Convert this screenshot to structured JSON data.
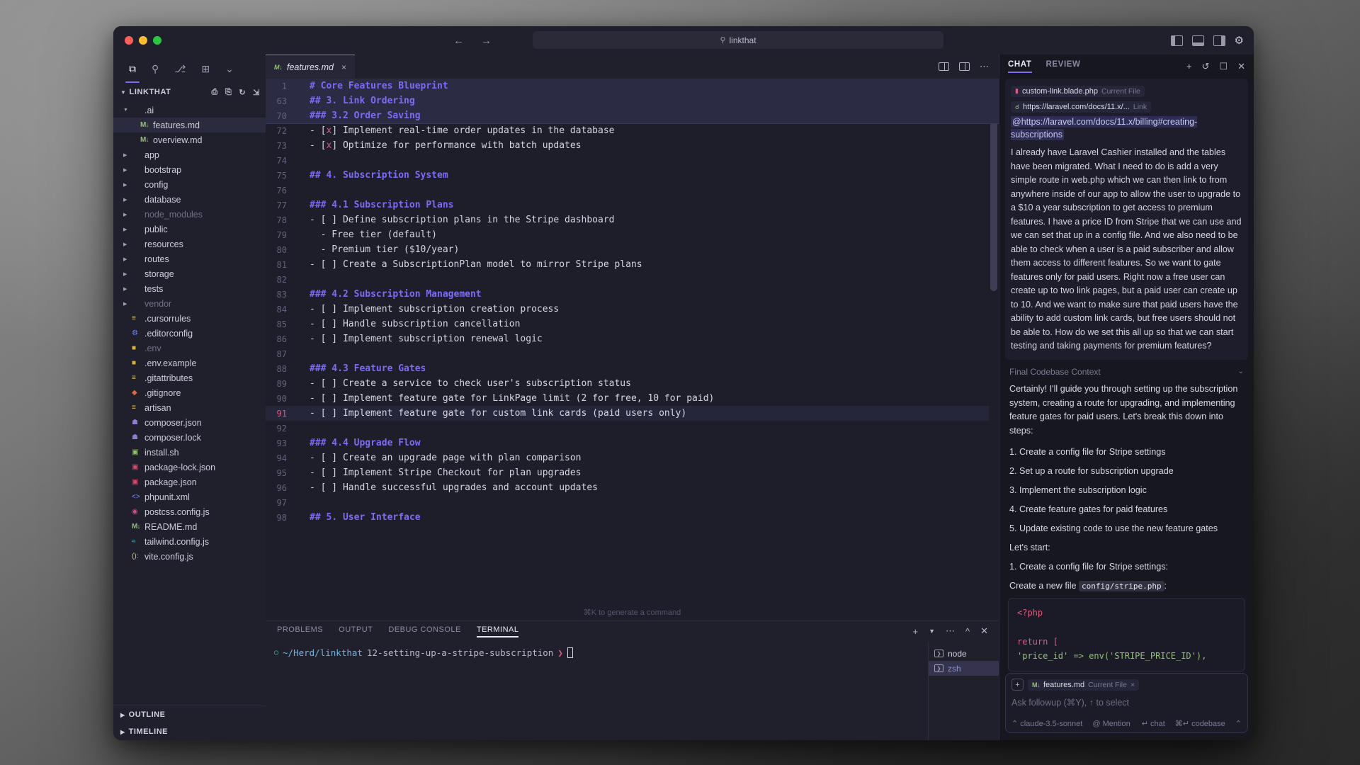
{
  "titlebar": {
    "search_value": "linkthat",
    "search_icon": "magnifier-icon",
    "back_icon": "←",
    "forward_icon": "→",
    "gear_icon": "⚙"
  },
  "activitybar": {
    "items": [
      {
        "name": "explorer",
        "glyph": "⧉"
      },
      {
        "name": "search",
        "glyph": "⚲"
      },
      {
        "name": "source-control",
        "glyph": "⎇"
      },
      {
        "name": "extensions",
        "glyph": "⊞"
      },
      {
        "name": "more",
        "glyph": "⌄"
      }
    ]
  },
  "sidebar": {
    "title": "LINKTHAT",
    "actions": [
      "new-file",
      "new-folder",
      "refresh",
      "collapse-all"
    ],
    "tree": [
      {
        "label": ".ai",
        "type": "folder",
        "expanded": true,
        "indent": 0
      },
      {
        "label": "features.md",
        "type": "md",
        "indent": 1,
        "selected": true
      },
      {
        "label": "overview.md",
        "type": "md",
        "indent": 1
      },
      {
        "label": "app",
        "type": "folder",
        "indent": 0
      },
      {
        "label": "bootstrap",
        "type": "folder",
        "indent": 0
      },
      {
        "label": "config",
        "type": "folder",
        "indent": 0
      },
      {
        "label": "database",
        "type": "folder",
        "indent": 0
      },
      {
        "label": "node_modules",
        "type": "folder",
        "indent": 0,
        "dim": true
      },
      {
        "label": "public",
        "type": "folder",
        "indent": 0
      },
      {
        "label": "resources",
        "type": "folder",
        "indent": 0
      },
      {
        "label": "routes",
        "type": "folder",
        "indent": 0
      },
      {
        "label": "storage",
        "type": "folder",
        "indent": 0
      },
      {
        "label": "tests",
        "type": "folder",
        "indent": 0
      },
      {
        "label": "vendor",
        "type": "folder",
        "indent": 0,
        "dim": true
      },
      {
        "label": ".cursorrules",
        "type": "text",
        "indent": 0
      },
      {
        "label": ".editorconfig",
        "type": "gear",
        "indent": 0
      },
      {
        "label": ".env",
        "type": "lock",
        "indent": 0,
        "dim": true
      },
      {
        "label": ".env.example",
        "type": "lock",
        "indent": 0
      },
      {
        "label": ".gitattributes",
        "type": "text",
        "indent": 0
      },
      {
        "label": ".gitignore",
        "type": "git",
        "indent": 0
      },
      {
        "label": "artisan",
        "type": "text",
        "indent": 0
      },
      {
        "label": "composer.json",
        "type": "composer",
        "indent": 0
      },
      {
        "label": "composer.lock",
        "type": "composer",
        "indent": 0
      },
      {
        "label": "install.sh",
        "type": "shell",
        "indent": 0
      },
      {
        "label": "package-lock.json",
        "type": "npm",
        "indent": 0
      },
      {
        "label": "package.json",
        "type": "npm",
        "indent": 0
      },
      {
        "label": "phpunit.xml",
        "type": "xml",
        "indent": 0
      },
      {
        "label": "postcss.config.js",
        "type": "postcss",
        "indent": 0
      },
      {
        "label": "README.md",
        "type": "md",
        "indent": 0
      },
      {
        "label": "tailwind.config.js",
        "type": "tailwind",
        "indent": 0
      },
      {
        "label": "vite.config.js",
        "type": "vite",
        "indent": 0
      }
    ],
    "bottom_sections": [
      "OUTLINE",
      "TIMELINE"
    ]
  },
  "editor": {
    "tab": {
      "label": "features.md",
      "icon": "markdown-icon",
      "close": "×"
    },
    "actions": [
      "split-editor",
      "layout-toggle",
      "more-actions"
    ],
    "sticky_lines": [
      {
        "num": "1",
        "text": "# Core Features Blueprint",
        "style": "h"
      },
      {
        "num": "63",
        "text": "## 3. Link Ordering",
        "style": "h"
      },
      {
        "num": "70",
        "text": "### 3.2 Order Saving",
        "style": "h"
      }
    ],
    "lines": [
      {
        "num": "72",
        "text": "- [x] Implement real-time order updates in the database",
        "style": "task-done"
      },
      {
        "num": "73",
        "text": "- [x] Optimize for performance with batch updates",
        "style": "task-done"
      },
      {
        "num": "74",
        "text": "",
        "style": "blank"
      },
      {
        "num": "75",
        "text": "## 4. Subscription System",
        "style": "h"
      },
      {
        "num": "76",
        "text": "",
        "style": "blank"
      },
      {
        "num": "77",
        "text": "### 4.1 Subscription Plans",
        "style": "h"
      },
      {
        "num": "78",
        "text": "- [ ] Define subscription plans in the Stripe dashboard",
        "style": "task"
      },
      {
        "num": "79",
        "text": "  - Free tier (default)",
        "style": "plain"
      },
      {
        "num": "80",
        "text": "  - Premium tier ($10/year)",
        "style": "plain"
      },
      {
        "num": "81",
        "text": "- [ ] Create a SubscriptionPlan model to mirror Stripe plans",
        "style": "task"
      },
      {
        "num": "82",
        "text": "",
        "style": "blank"
      },
      {
        "num": "83",
        "text": "### 4.2 Subscription Management",
        "style": "h"
      },
      {
        "num": "84",
        "text": "- [ ] Implement subscription creation process",
        "style": "task"
      },
      {
        "num": "85",
        "text": "- [ ] Handle subscription cancellation",
        "style": "task"
      },
      {
        "num": "86",
        "text": "- [ ] Implement subscription renewal logic",
        "style": "task"
      },
      {
        "num": "87",
        "text": "",
        "style": "blank"
      },
      {
        "num": "88",
        "text": "### 4.3 Feature Gates",
        "style": "h"
      },
      {
        "num": "89",
        "text": "- [ ] Create a service to check user's subscription status",
        "style": "task"
      },
      {
        "num": "90",
        "text": "- [ ] Implement feature gate for LinkPage limit (2 for free, 10 for paid)",
        "style": "task"
      },
      {
        "num": "91",
        "text": "- [ ] Implement feature gate for custom link cards (paid users only)",
        "style": "task",
        "current": true
      },
      {
        "num": "92",
        "text": "",
        "style": "blank"
      },
      {
        "num": "93",
        "text": "### 4.4 Upgrade Flow",
        "style": "h"
      },
      {
        "num": "94",
        "text": "- [ ] Create an upgrade page with plan comparison",
        "style": "task"
      },
      {
        "num": "95",
        "text": "- [ ] Implement Stripe Checkout for plan upgrades",
        "style": "task"
      },
      {
        "num": "96",
        "text": "- [ ] Handle successful upgrades and account updates",
        "style": "task"
      },
      {
        "num": "97",
        "text": "",
        "style": "blank"
      },
      {
        "num": "98",
        "text": "## 5. User Interface",
        "style": "h"
      }
    ],
    "generate_hint": "⌘K to generate a command"
  },
  "panel": {
    "tabs": [
      {
        "label": "PROBLEMS",
        "active": false
      },
      {
        "label": "OUTPUT",
        "active": false
      },
      {
        "label": "DEBUG CONSOLE",
        "active": false
      },
      {
        "label": "TERMINAL",
        "active": true
      }
    ],
    "actions": [
      "add-terminal",
      "split-terminal",
      "more",
      "chevron-up",
      "close-panel"
    ],
    "terminal": {
      "status_dot": "○",
      "path": "~/Herd/linkthat",
      "branch": "12-setting-up-a-stripe-subscription",
      "arrow": "❯",
      "cursor": ""
    },
    "terminal_list": [
      {
        "label": "node",
        "selected": false
      },
      {
        "label": "zsh",
        "selected": true
      }
    ]
  },
  "chat": {
    "tabs": [
      {
        "label": "CHAT",
        "active": true
      },
      {
        "label": "REVIEW",
        "active": false
      }
    ],
    "actions": [
      "new-chat",
      "history",
      "expand",
      "close"
    ],
    "user_message": {
      "chips": [
        {
          "label": "custom-link.blade.php",
          "sub": "Current File",
          "icon": "blade-icon"
        },
        {
          "label": "https://laravel.com/docs/11.x/...",
          "sub": "Link",
          "icon": "link-icon"
        }
      ],
      "mention": "@https://laravel.com/docs/11.x/billing#creating-subscriptions",
      "text": "I already have Laravel Cashier installed and the tables have been migrated. What I need to do is add a very simple route in web.php which we can then link to from anywhere inside of our app to allow the user to upgrade to a $10 a year subscription to get access to premium features. I have a price ID from Stripe that we can use and we can set that up in a config file. And we also need to be able to check when a user is a paid subscriber and allow them access to different features. So we want to gate features only for paid users. Right now a free user can create up to two link pages, but a paid user can create up to 10. And we want to make sure that paid users have the ability to add custom link cards, but free users should not be able to. How do we set this all up so that we can start testing and taking payments for premium features?"
    },
    "context_row": {
      "label": "Final Codebase Context",
      "chevron": "⌄"
    },
    "assistant": {
      "intro": "Certainly! I'll guide you through setting up the subscription system, creating a route for upgrading, and implementing feature gates for paid users. Let's break this down into steps:",
      "steps": [
        "1. Create a config file for Stripe settings",
        "2. Set up a route for subscription upgrade",
        "3. Implement the subscription logic",
        "4. Create feature gates for paid features",
        "5. Update existing code to use the new feature gates"
      ],
      "lets_start": "Let's start:",
      "first_step": "1. Create a config file for Stripe settings:",
      "create_prefix": "Create a new file",
      "create_file": "config/stripe.php",
      "create_suffix": ":",
      "code": [
        {
          "text": "<?php",
          "cls": "kw"
        },
        {
          "text": "",
          "cls": "plain"
        },
        {
          "text": "return [",
          "cls": "kw"
        },
        {
          "text": "    'price_id' => env('STRIPE_PRICE_ID'),",
          "cls": "str"
        }
      ]
    },
    "input": {
      "plus": "+",
      "chip_label": "features.md",
      "chip_sub": "Current File",
      "chip_close": "×",
      "placeholder": "Ask followup (⌘Y), ↑ to select",
      "model": "claude-3.5-sonnet",
      "mention": "@ Mention",
      "chat_hint": "↵ chat",
      "codebase_hint": "⌘↵ codebase"
    }
  }
}
